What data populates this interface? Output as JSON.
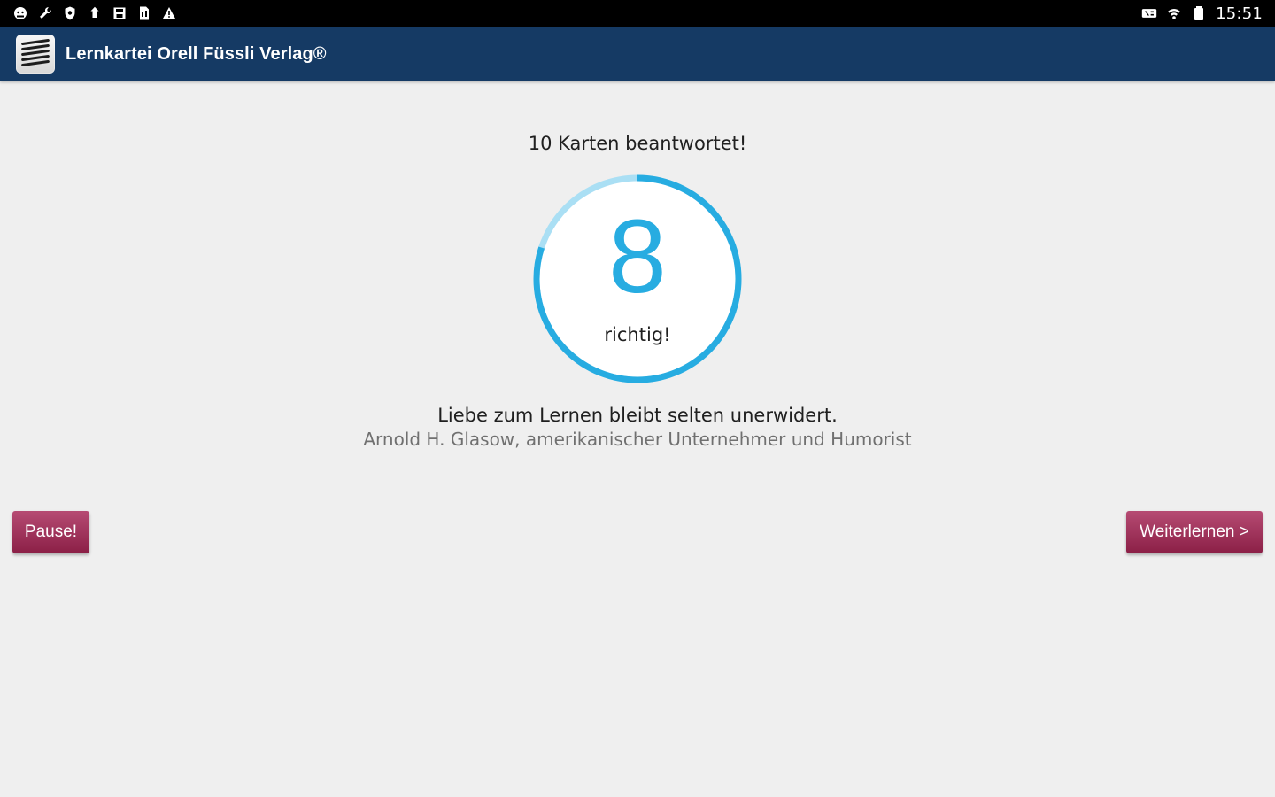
{
  "status_bar": {
    "left_icons": [
      "android-debug-icon",
      "wrench-icon",
      "shield-icon",
      "upload-icon",
      "save-icon",
      "sim-icon",
      "warning-icon"
    ],
    "right_icons": [
      "nfc-icon",
      "wifi-icon",
      "battery-icon"
    ],
    "time": "15:51"
  },
  "app_bar": {
    "title": "Lernkartei Orell Füssli Verlag®"
  },
  "summary": {
    "answered_text": "10 Karten beantwortet!",
    "correct_count": "8",
    "correct_label": "richtig!",
    "progress_fraction": 0.8
  },
  "quote": {
    "text": "Liebe zum Lernen bleibt selten unerwidert.",
    "author": "Arnold H. Glasow, amerikanischer Unternehmer und Humorist"
  },
  "buttons": {
    "pause": "Pause!",
    "continue": "Weiterlernen >"
  },
  "colors": {
    "status_bar": "#000000",
    "app_bar": "#153a64",
    "background": "#efefef",
    "progress_primary": "#27ace1",
    "progress_secondary": "#aadff4",
    "button": "#8b1f46"
  }
}
